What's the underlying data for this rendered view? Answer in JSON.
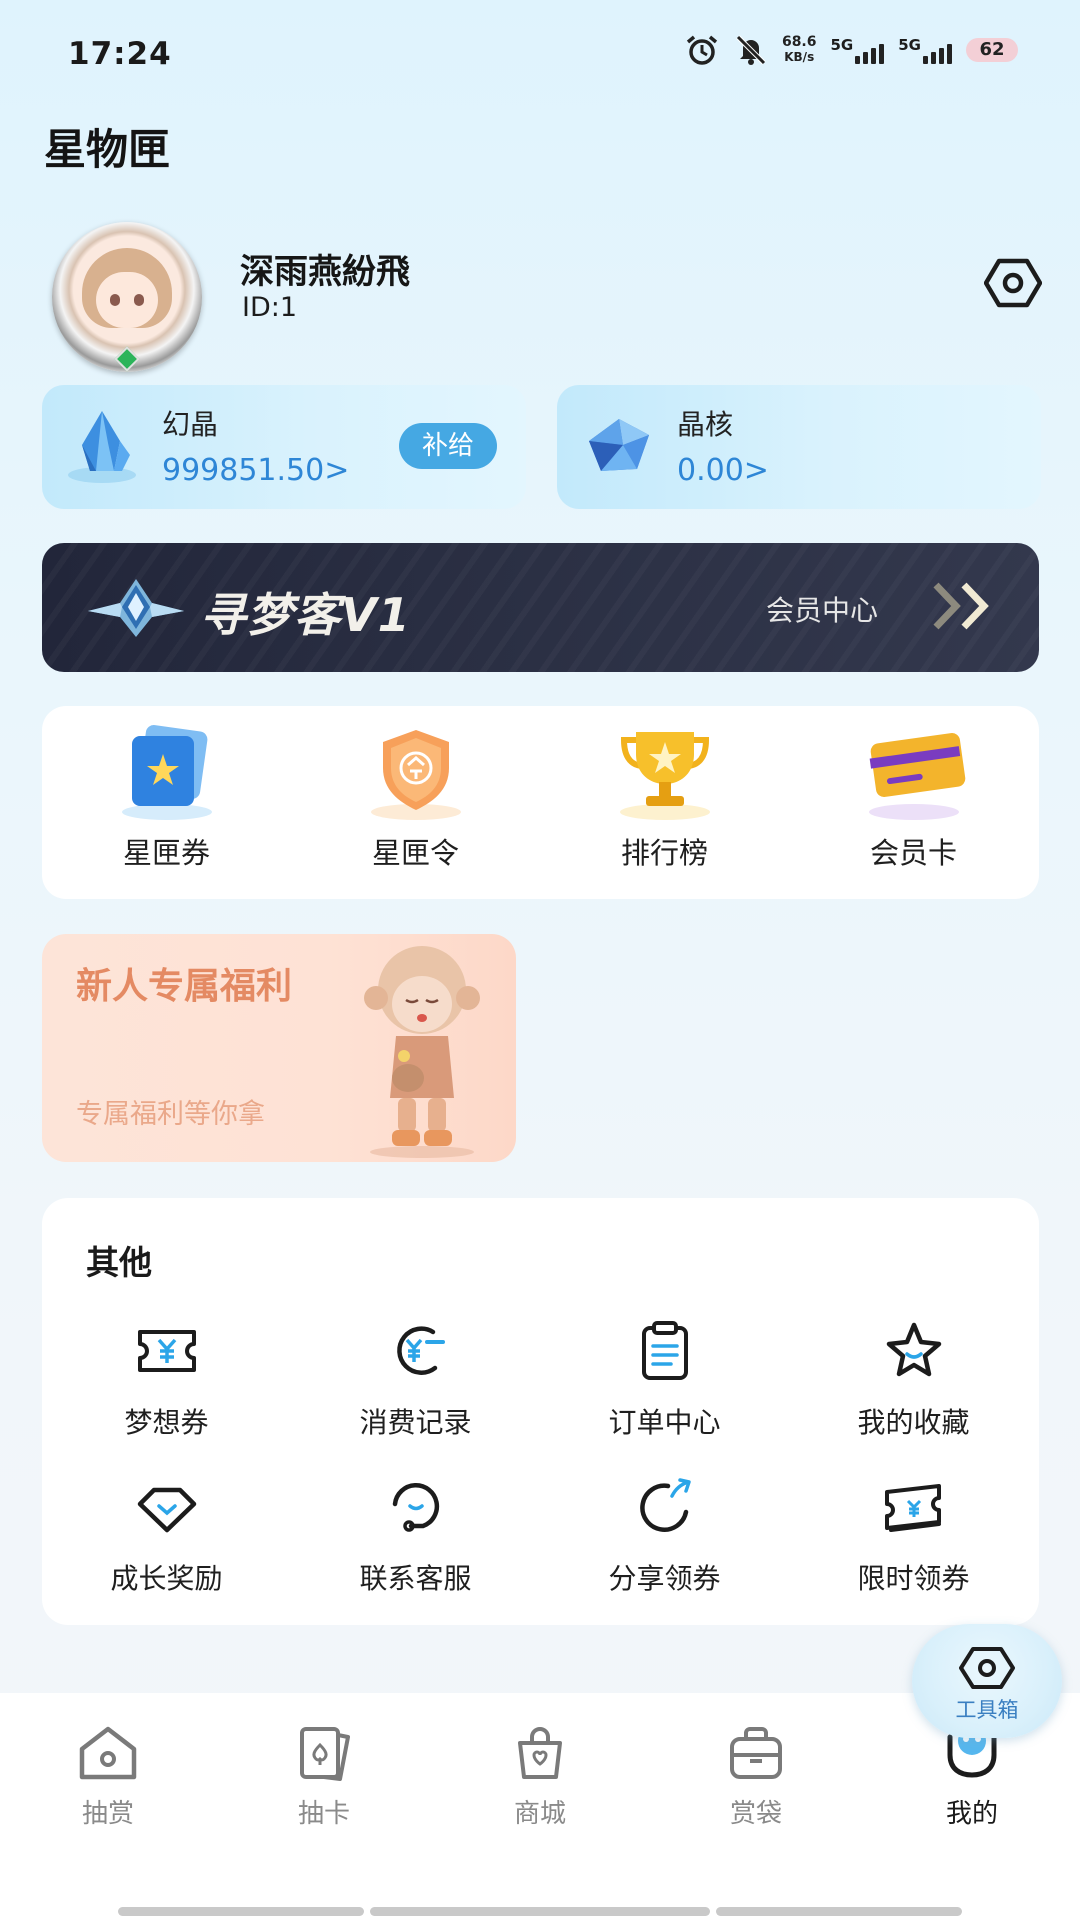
{
  "status_bar": {
    "time": "17:24",
    "net_speed_value": "68.6",
    "net_speed_unit": "KB/s",
    "sim1_label": "5G",
    "sim2_label": "5G",
    "battery": "62"
  },
  "page": {
    "title": "星物匣"
  },
  "profile": {
    "name": "深雨燕紛飛",
    "id_text": "ID:1"
  },
  "wallet": {
    "crystal": {
      "label": "幻晶",
      "value": "999851.50>",
      "supply_label": "补给"
    },
    "core": {
      "label": "晶核",
      "value": "0.00>"
    }
  },
  "membership": {
    "level": "寻梦客V1",
    "center_label": "会员中心"
  },
  "quick_actions": [
    {
      "label": "星匣券",
      "icon": "ticket-star-icon"
    },
    {
      "label": "星匣令",
      "icon": "shield-token-icon"
    },
    {
      "label": "排行榜",
      "icon": "trophy-icon"
    },
    {
      "label": "会员卡",
      "icon": "member-card-icon"
    }
  ],
  "newcomer": {
    "title": "新人专属福利",
    "subtitle": "专属福利等你拿"
  },
  "other": {
    "title": "其他",
    "items": [
      {
        "label": "梦想券",
        "icon": "coupon-yen-icon"
      },
      {
        "label": "消费记录",
        "icon": "spending-record-icon"
      },
      {
        "label": "订单中心",
        "icon": "clipboard-icon"
      },
      {
        "label": "我的收藏",
        "icon": "star-icon"
      },
      {
        "label": "成长奖励",
        "icon": "diamond-icon"
      },
      {
        "label": "联系客服",
        "icon": "customer-service-icon"
      },
      {
        "label": "分享领券",
        "icon": "share-icon"
      },
      {
        "label": "限时领券",
        "icon": "limited-coupon-icon"
      }
    ]
  },
  "toolbox": {
    "label": "工具箱"
  },
  "tabs": [
    {
      "label": "抽赏",
      "icon": "home-icon",
      "active": false
    },
    {
      "label": "抽卡",
      "icon": "cards-icon",
      "active": false
    },
    {
      "label": "商城",
      "icon": "shopping-bag-icon",
      "active": false
    },
    {
      "label": "赏袋",
      "icon": "backpack-icon",
      "active": false
    },
    {
      "label": "我的",
      "icon": "profile-robot-icon",
      "active": true
    }
  ],
  "colors": {
    "accent": "#2e86d6",
    "supply_button": "#45a8e3",
    "banner_dark": "#272b3f",
    "newcomer_text": "#e48a63"
  }
}
